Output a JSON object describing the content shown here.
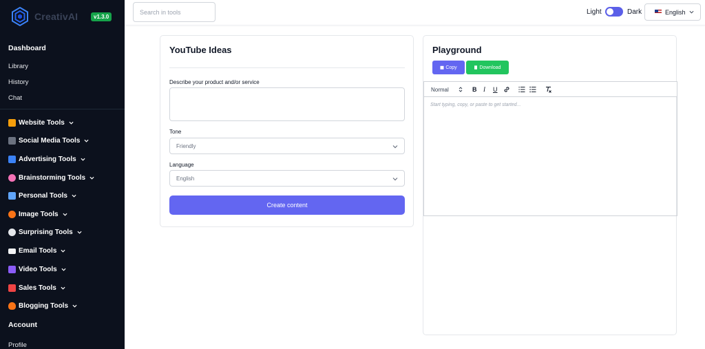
{
  "app": {
    "name": "CreativAI",
    "version": "v1.3.0"
  },
  "sidebar": {
    "dashboard": "Dashboard",
    "items": [
      "Library",
      "History",
      "Chat"
    ],
    "tools": [
      {
        "label": "Website Tools",
        "icon": "construction-icon",
        "color": "#f59e0b"
      },
      {
        "label": "Social Media Tools",
        "icon": "phone-icon",
        "color": "#6b7280"
      },
      {
        "label": "Advertising Tools",
        "icon": "chart-icon",
        "color": "#3b82f6"
      },
      {
        "label": "Brainstorming Tools",
        "icon": "brain-icon",
        "color": "#f472b6"
      },
      {
        "label": "Personal Tools",
        "icon": "laptop-icon",
        "color": "#60a5fa"
      },
      {
        "label": "Image Tools",
        "icon": "palette-icon",
        "color": "#f97316"
      },
      {
        "label": "Surprising Tools",
        "icon": "skull-icon",
        "color": "#e5e7eb"
      },
      {
        "label": "Email Tools",
        "icon": "envelope-icon",
        "color": "#f3f4f6"
      },
      {
        "label": "Video Tools",
        "icon": "video-icon",
        "color": "#8b5cf6"
      },
      {
        "label": "Sales Tools",
        "icon": "trend-icon",
        "color": "#ef4444"
      },
      {
        "label": "Blogging Tools",
        "icon": "fire-icon",
        "color": "#f97316"
      }
    ],
    "account": "Account",
    "profile": "Profile"
  },
  "topbar": {
    "search_placeholder": "Search in tools",
    "theme_light": "Light",
    "theme_dark": "Dark",
    "language": "English"
  },
  "form": {
    "title": "YouTube Ideas",
    "description_label": "Describe your product and/or service",
    "description_value": "",
    "tone_label": "Tone",
    "tone_value": "Friendly",
    "language_label": "Language",
    "language_value": "English",
    "submit_label": "Create content"
  },
  "playground": {
    "title": "Playground",
    "copy_label": "Copy",
    "download_label": "Download",
    "heading_select": "Normal",
    "toolbar": [
      "B",
      "I",
      "U"
    ],
    "editor_placeholder": "Start typing, copy, or paste to get started..."
  },
  "colors": {
    "sidebar_bg": "#0c111d",
    "accent": "#6366f1",
    "success": "#22c55e",
    "badge": "#16a34a"
  }
}
